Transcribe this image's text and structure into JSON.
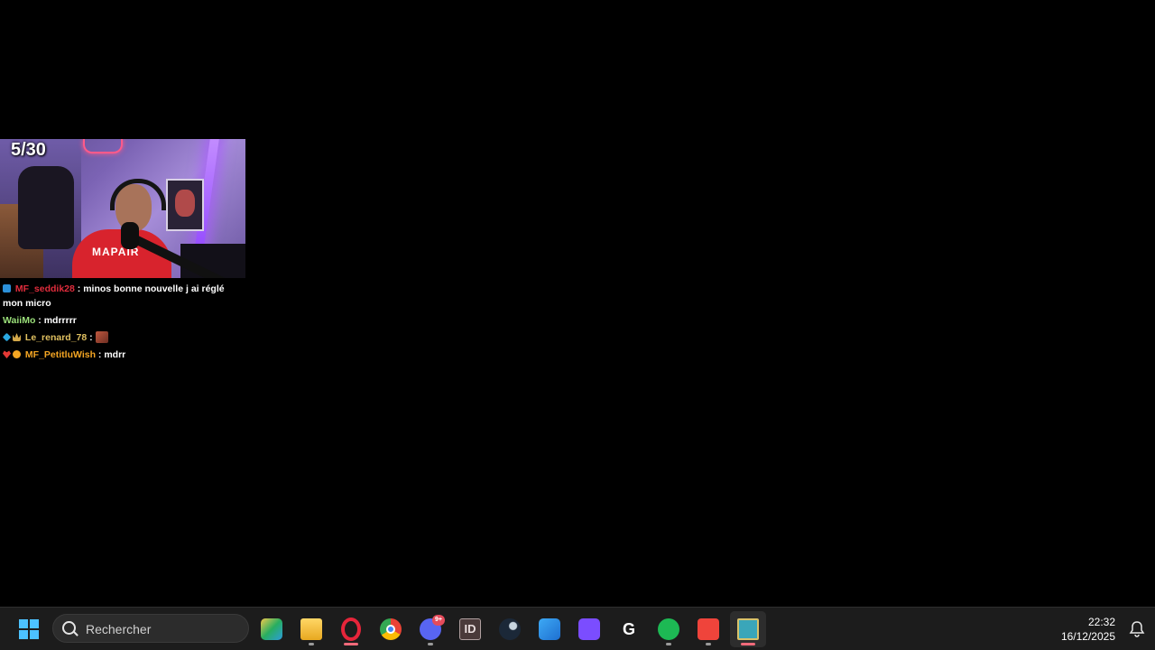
{
  "stream": {
    "counter": "5/30"
  },
  "chat": {
    "messages": [
      {
        "user": "MF_seddik28",
        "user_color": "#e02c3c",
        "badges": [
          "mod"
        ],
        "text": "minos bonne nouvelle j ai réglé mon micro",
        "separator": " : "
      },
      {
        "user": "WaiiMo",
        "user_color": "#9be07a",
        "badges": [],
        "text": "mdrrrrr",
        "separator": " : "
      },
      {
        "user": "Le_renard_78",
        "user_color": "#e0c060",
        "badges": [
          "gem",
          "crown"
        ],
        "text": "",
        "separator": " : ",
        "emote": "emote"
      },
      {
        "user": "MF_PetitluWish",
        "user_color": "#f5a623",
        "badges": [
          "heart",
          "info"
        ],
        "text": "mdrr",
        "separator": " : "
      }
    ]
  },
  "taskbar": {
    "search_placeholder": "Rechercher",
    "apps": [
      {
        "name": "bluestacks",
        "color": "#f2c94c"
      },
      {
        "name": "file-explorer",
        "color": "#f4c542"
      },
      {
        "name": "opera",
        "color": "#e6253a"
      },
      {
        "name": "chrome",
        "color": "#34a853"
      },
      {
        "name": "discord",
        "color": "#5865f2",
        "badge": "9+"
      },
      {
        "name": "indesign",
        "color": "#3a2a2a"
      },
      {
        "name": "steam",
        "color": "#1b2838"
      },
      {
        "name": "affinity",
        "color": "#3da9f5"
      },
      {
        "name": "wondershare",
        "color": "#7b4dff"
      },
      {
        "name": "logitech-g",
        "color": "#0b0b0b"
      },
      {
        "name": "spotify",
        "color": "#1db954"
      },
      {
        "name": "anydesk",
        "color": "#ef443b"
      },
      {
        "name": "task-app",
        "color": "#3aa6b9"
      }
    ],
    "clock": {
      "time": "22:32",
      "date": "16/12/2025"
    }
  }
}
